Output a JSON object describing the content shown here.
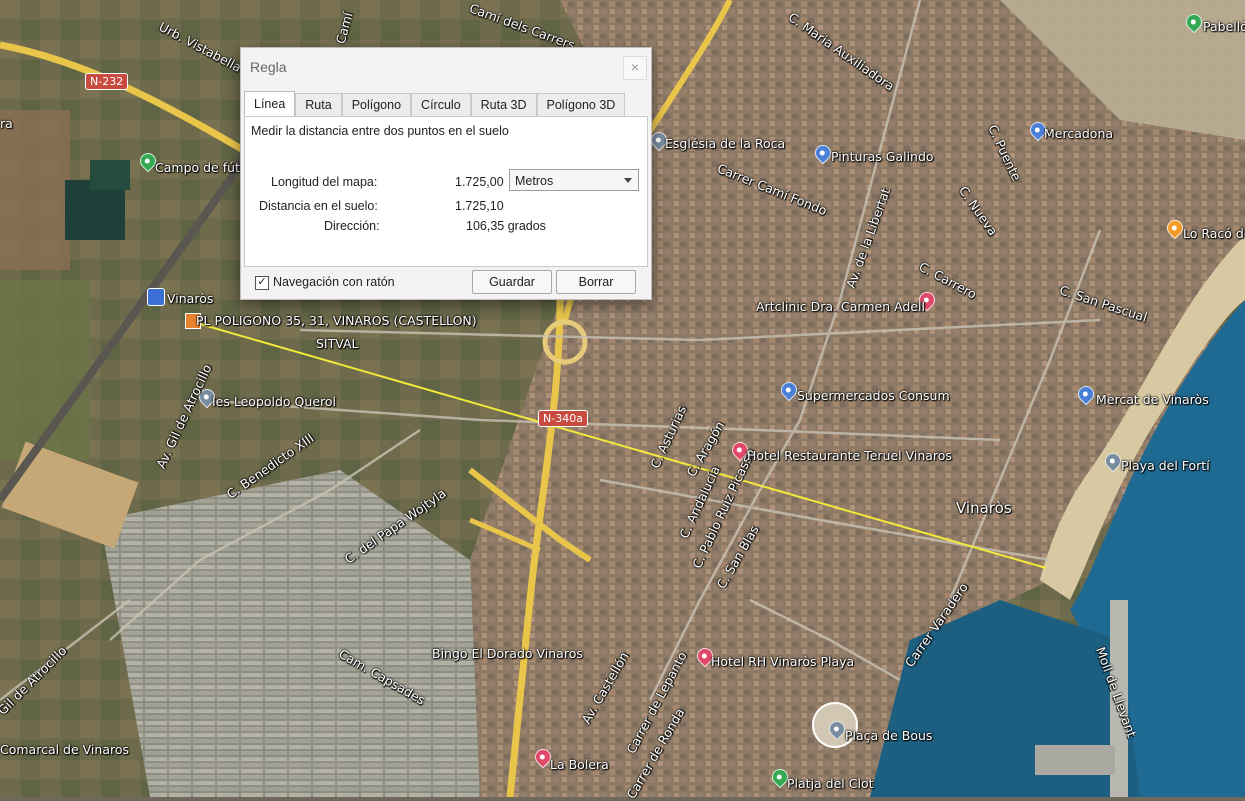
{
  "dialog": {
    "title": "Regla",
    "close_glyph": "×",
    "tabs": [
      "Línea",
      "Ruta",
      "Polígono",
      "Círculo",
      "Ruta 3D",
      "Polígono 3D"
    ],
    "active_tab": "Línea",
    "description": "Medir la distancia entre dos puntos en el suelo",
    "map_length_label": "Longitud del mapa:",
    "map_length_value": "1.725,00",
    "unit": "Metros",
    "ground_distance_label": "Distancia en el suelo:",
    "ground_distance_value": "1.725,10",
    "heading_label": "Dirección:",
    "heading_value": "106,35 grados",
    "mouse_nav_label": "Navegación con ratón",
    "mouse_nav_checked": true,
    "save_label": "Guardar",
    "clear_label": "Borrar"
  },
  "map": {
    "ruler_color": "#f2e93a",
    "road_shields": [
      "N-232",
      "N-340a"
    ],
    "labels": [
      "Urb. Vistabella C.",
      "C. Maria Auxiliadora",
      "Camí",
      "Camí dels Carrers",
      "C. Puente",
      "C. Nueva",
      "Av. de la Libertat",
      "C. Carrero",
      "C. San Pascual",
      "Església de la Roca",
      "Carrer Camí Fondo",
      "Pinturas Galindo",
      "Mercadona",
      "Pabellón",
      "Lo Racó de",
      "Campo de fútbol",
      "Vinaròs",
      "PL POLIGONO 35, 31, VINAROS (CASTELLON)",
      "SITVAL",
      "Artclinic Dra. Carmen Adell",
      "Supermercados Consum",
      "Mercat de Vinaròs",
      "Ies Leopoldo Querol",
      "Av. Gil de Atrocillo",
      "C. Benedicto XIII",
      "C. Asturias",
      "C. Aragón",
      "C. Andalucía",
      "C. Pablo Ruiz Picasso",
      "C. San Blas",
      "Hotel Restaurante Teruel Vinaros",
      "Playa del Fortí",
      "Vinaròs",
      "C. del Papa Wojtyla",
      "Carrer Varadero",
      "Moll de Llevant",
      "Cam. Capsades",
      "Bingo El Dorado Vinaros",
      "Av. Castellón",
      "Carrer de Lepanto",
      "Hotel RH Vinaròs Playa",
      "Plaça de Bous",
      "La Bolera",
      "Carrer de Ronda",
      "Platja del Clot",
      "Gil de Atrocillo",
      "Comarcal de Vinaros",
      "ra"
    ]
  }
}
